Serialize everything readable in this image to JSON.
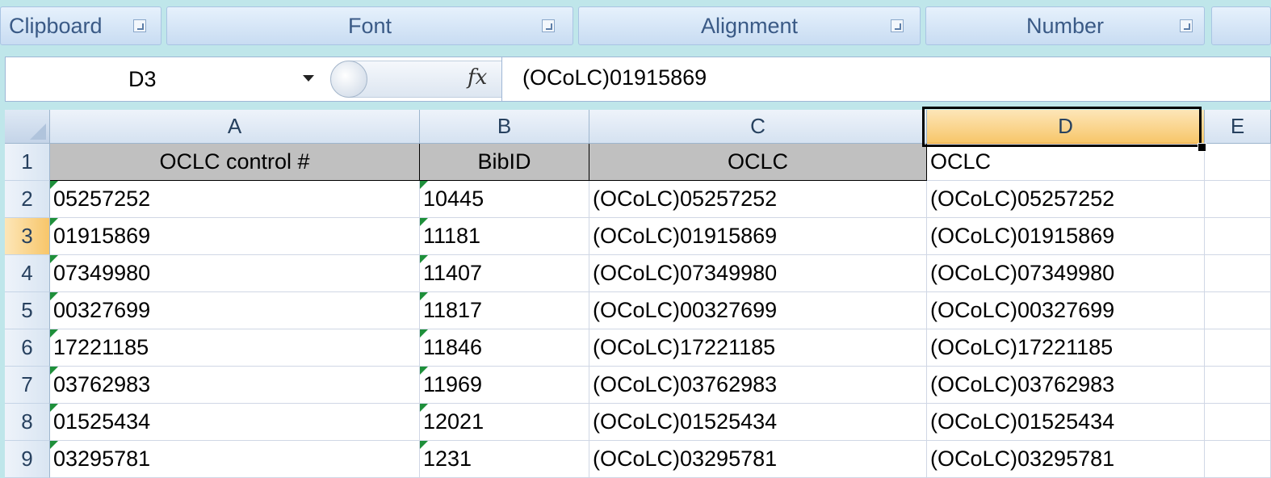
{
  "ribbon": {
    "groups": [
      "Clipboard",
      "Font",
      "Alignment",
      "Number",
      ""
    ]
  },
  "formula_bar": {
    "name_box": "D3",
    "fx_symbol": "fx",
    "formula": "(OCoLC)01915869"
  },
  "grid": {
    "columns": [
      "A",
      "B",
      "C",
      "D",
      "E"
    ],
    "active_column": "D",
    "active_row": "3",
    "rows": [
      {
        "num": "1",
        "cells": [
          "OCLC control #",
          "BibID",
          "OCLC",
          "OCLC",
          ""
        ]
      },
      {
        "num": "2",
        "cells": [
          "05257252",
          "10445",
          "(OCoLC)05257252",
          "(OCoLC)05257252",
          ""
        ]
      },
      {
        "num": "3",
        "cells": [
          "01915869",
          "11181",
          "(OCoLC)01915869",
          "(OCoLC)01915869",
          ""
        ]
      },
      {
        "num": "4",
        "cells": [
          "07349980",
          "11407",
          "(OCoLC)07349980",
          "(OCoLC)07349980",
          ""
        ]
      },
      {
        "num": "5",
        "cells": [
          "00327699",
          "11817",
          "(OCoLC)00327699",
          "(OCoLC)00327699",
          ""
        ]
      },
      {
        "num": "6",
        "cells": [
          "17221185",
          "11846",
          "(OCoLC)17221185",
          "(OCoLC)17221185",
          ""
        ]
      },
      {
        "num": "7",
        "cells": [
          "03762983",
          "11969",
          "(OCoLC)03762983",
          "(OCoLC)03762983",
          ""
        ]
      },
      {
        "num": "8",
        "cells": [
          "01525434",
          "12021",
          "(OCoLC)01525434",
          "(OCoLC)01525434",
          ""
        ]
      },
      {
        "num": "9",
        "cells": [
          "03295781",
          "1231",
          "(OCoLC)03295781",
          "(OCoLC)03295781",
          ""
        ]
      }
    ]
  }
}
